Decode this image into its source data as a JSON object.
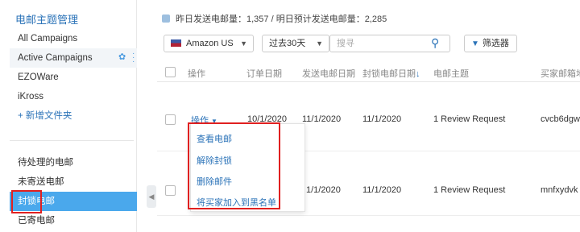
{
  "sidebar": {
    "title": "电邮主题管理",
    "campaigns": [
      "All Campaigns",
      "Active Campaigns",
      "EZOWare",
      "iKross"
    ],
    "new_folder": "+ 新增文件夹",
    "email_items": [
      "待处理的电邮",
      "未寄送电邮",
      "封锁电邮",
      "已寄电邮"
    ],
    "selected": "封锁电邮"
  },
  "stats": {
    "text": "昨日发送电邮量：1,357 / 明日预计发送电邮量：2,285"
  },
  "filters": {
    "marketplace": "Amazon US",
    "date_range": "过去30天",
    "search_placeholder": "搜寻",
    "filter_label": "筛选器"
  },
  "table": {
    "columns": [
      "操作",
      "订单日期",
      "发送电邮日期",
      "封锁电邮日期",
      "电邮主题",
      "买家邮箱地"
    ],
    "sorted_column_arrow": "↓",
    "rows": [
      {
        "action": "操作",
        "order_date": "10/1/2020",
        "send_date": "11/1/2020",
        "block_date": "11/1/2020",
        "subject": "1 Review Request",
        "buyer": "cvcb6dgw"
      },
      {
        "action": "",
        "order_date": "",
        "send_date": "1/1/2020",
        "block_date": "11/1/2020",
        "subject": "1 Review Request",
        "buyer": "mnfxydvk"
      }
    ]
  },
  "action_menu": {
    "items": [
      "查看电邮",
      "解除封锁",
      "删除邮件",
      "将买家加入到黑名单"
    ]
  },
  "colors": {
    "accent": "#2b73b8",
    "selected_bg": "#4aa8ec",
    "highlight_red": "#e02020"
  }
}
